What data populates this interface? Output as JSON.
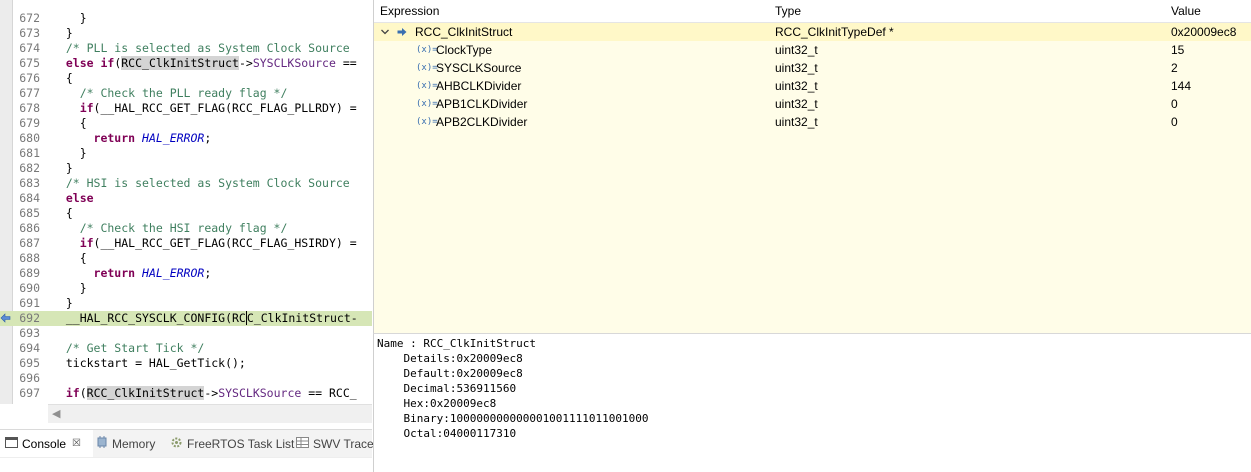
{
  "editor": {
    "lines": [
      {
        "n": "672",
        "segs": [
          [
            "",
            "    }"
          ]
        ]
      },
      {
        "n": "673",
        "segs": [
          [
            "",
            "  }"
          ]
        ]
      },
      {
        "n": "674",
        "segs": [
          [
            "c",
            "  /* PLL is selected as System Clock Source"
          ]
        ]
      },
      {
        "n": "675",
        "segs": [
          [
            "k",
            "  else if"
          ],
          [
            "",
            "("
          ],
          [
            "h",
            "RCC_ClkInitStruct"
          ],
          [
            "",
            "->"
          ],
          [
            "f",
            "SYSCLKSource"
          ],
          [
            "",
            " =="
          ]
        ]
      },
      {
        "n": "676",
        "segs": [
          [
            "",
            "  {"
          ]
        ]
      },
      {
        "n": "677",
        "segs": [
          [
            "c",
            "    /* Check the PLL ready flag */"
          ]
        ]
      },
      {
        "n": "678",
        "segs": [
          [
            "k",
            "    if"
          ],
          [
            "",
            "(__HAL_RCC_GET_FLAG(RCC_FLAG_PLLRDY) ="
          ]
        ]
      },
      {
        "n": "679",
        "segs": [
          [
            "",
            "    {"
          ]
        ]
      },
      {
        "n": "680",
        "segs": [
          [
            "k",
            "      return "
          ],
          [
            "i",
            "HAL_ERROR"
          ],
          [
            "",
            ";"
          ]
        ]
      },
      {
        "n": "681",
        "segs": [
          [
            "",
            "    }"
          ]
        ]
      },
      {
        "n": "682",
        "segs": [
          [
            "",
            "  }"
          ]
        ]
      },
      {
        "n": "683",
        "segs": [
          [
            "c",
            "  /* HSI is selected as System Clock Source"
          ]
        ]
      },
      {
        "n": "684",
        "segs": [
          [
            "k",
            "  else"
          ]
        ]
      },
      {
        "n": "685",
        "segs": [
          [
            "",
            "  {"
          ]
        ]
      },
      {
        "n": "686",
        "segs": [
          [
            "c",
            "    /* Check the HSI ready flag */"
          ]
        ]
      },
      {
        "n": "687",
        "segs": [
          [
            "k",
            "    if"
          ],
          [
            "",
            "(__HAL_RCC_GET_FLAG(RCC_FLAG_HSIRDY) ="
          ]
        ]
      },
      {
        "n": "688",
        "segs": [
          [
            "",
            "    {"
          ]
        ]
      },
      {
        "n": "689",
        "segs": [
          [
            "k",
            "      return "
          ],
          [
            "i",
            "HAL_ERROR"
          ],
          [
            "",
            ";"
          ]
        ]
      },
      {
        "n": "690",
        "segs": [
          [
            "",
            "    }"
          ]
        ]
      },
      {
        "n": "691",
        "segs": [
          [
            "",
            "  }"
          ]
        ]
      },
      {
        "n": "692",
        "hl": true,
        "segs": [
          [
            "",
            "  __HAL_RCC_SYSCLK_CONFIG(RC"
          ],
          [
            "cur",
            "C"
          ],
          [
            "",
            "_ClkInitStruct-"
          ]
        ]
      },
      {
        "n": "693",
        "segs": [
          [
            "",
            ""
          ]
        ]
      },
      {
        "n": "694",
        "segs": [
          [
            "c",
            "  /* Get Start Tick */"
          ]
        ]
      },
      {
        "n": "695",
        "segs": [
          [
            "",
            "  tickstart = HAL_GetTick();"
          ]
        ]
      },
      {
        "n": "696",
        "segs": [
          [
            "",
            ""
          ]
        ]
      },
      {
        "n": "697",
        "segs": [
          [
            "k",
            "  if"
          ],
          [
            "",
            "("
          ],
          [
            "h",
            "RCC_ClkInitStruct"
          ],
          [
            "",
            "->"
          ],
          [
            "f",
            "SYSCLKSource"
          ],
          [
            "",
            " == RCC_"
          ]
        ]
      }
    ]
  },
  "tabs": [
    {
      "label": "Console",
      "active": true,
      "icon": "console-icon",
      "close": "☒"
    },
    {
      "label": "Memory",
      "active": false,
      "icon": "memory-icon"
    },
    {
      "label": "FreeRTOS Task List",
      "active": false,
      "icon": "freertos-icon"
    },
    {
      "label": "SWV Trace",
      "active": false,
      "icon": "swv-trace-icon"
    }
  ],
  "expressions": {
    "headers": {
      "expression": "Expression",
      "type": "Type",
      "value": "Value"
    },
    "root": {
      "name": "RCC_ClkInitStruct",
      "type": "RCC_ClkInitTypeDef *",
      "value": "0x20009ec8"
    },
    "var_icon_text": "(x)=",
    "children": [
      {
        "name": "ClockType",
        "type": "uint32_t",
        "value": "15"
      },
      {
        "name": "SYSCLKSource",
        "type": "uint32_t",
        "value": "2"
      },
      {
        "name": "AHBCLKDivider",
        "type": "uint32_t",
        "value": "144"
      },
      {
        "name": "APB1CLKDivider",
        "type": "uint32_t",
        "value": "0"
      },
      {
        "name": "APB2CLKDivider",
        "type": "uint32_t",
        "value": "0"
      }
    ]
  },
  "details": [
    "Name : RCC_ClkInitStruct",
    "    Details:0x20009ec8",
    "    Default:0x20009ec8",
    "    Decimal:536911560",
    "    Hex:0x20009ec8",
    "    Binary:100000000000001001111011001000",
    "    Octal:04000117310"
  ],
  "colors": {
    "accent": "#3a6fb0",
    "highlight_line": "#d6e6b6",
    "table_row": "#fffde8"
  }
}
